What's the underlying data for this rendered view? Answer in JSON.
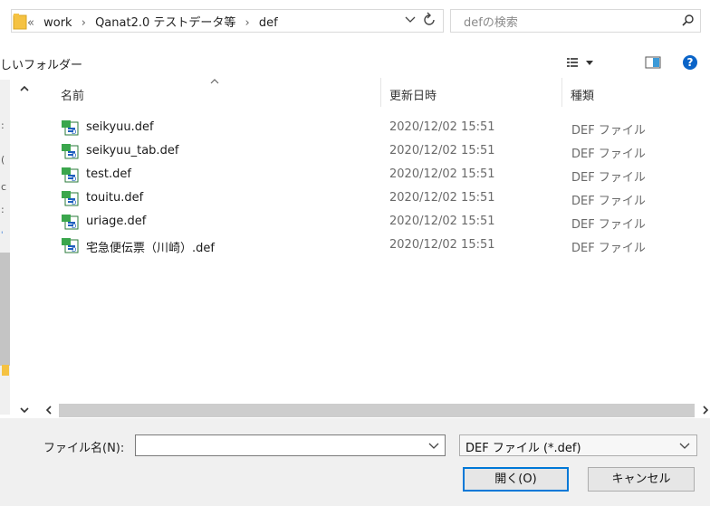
{
  "address_bar": {
    "breadcrumbs": [
      "«",
      "work",
      "Qanat2.0 テストデータ等",
      "def"
    ],
    "refresh_icon": "refresh-icon",
    "dropdown_icon": "chevron-down-icon"
  },
  "search": {
    "placeholder": "defの検索",
    "icon": "search-icon"
  },
  "toolbar": {
    "new_folder_label": "しいフォルダー"
  },
  "columns": {
    "name": "名前",
    "modified": "更新日時",
    "type": "種類"
  },
  "files": [
    {
      "name": "seikyuu.def",
      "modified": "2020/12/02 15:51",
      "type": "DEF ファイル"
    },
    {
      "name": "seikyuu_tab.def",
      "modified": "2020/12/02 15:51",
      "type": "DEF ファイル"
    },
    {
      "name": "test.def",
      "modified": "2020/12/02 15:51",
      "type": "DEF ファイル"
    },
    {
      "name": "touitu.def",
      "modified": "2020/12/02 15:51",
      "type": "DEF ファイル"
    },
    {
      "name": "uriage.def",
      "modified": "2020/12/02 15:51",
      "type": "DEF ファイル"
    },
    {
      "name": "宅急便伝票（川崎）.def",
      "modified": "2020/12/02 15:51",
      "type": "DEF ファイル"
    }
  ],
  "bottom": {
    "filename_label": "ファイル名(N):",
    "filename_value": "",
    "filter_value": "DEF ファイル (*.def)",
    "open_label": "開く(O)",
    "cancel_label": "キャンセル"
  },
  "colors": {
    "accent": "#0078d7",
    "help": "#0a64c8",
    "folder": "#f5c242"
  }
}
